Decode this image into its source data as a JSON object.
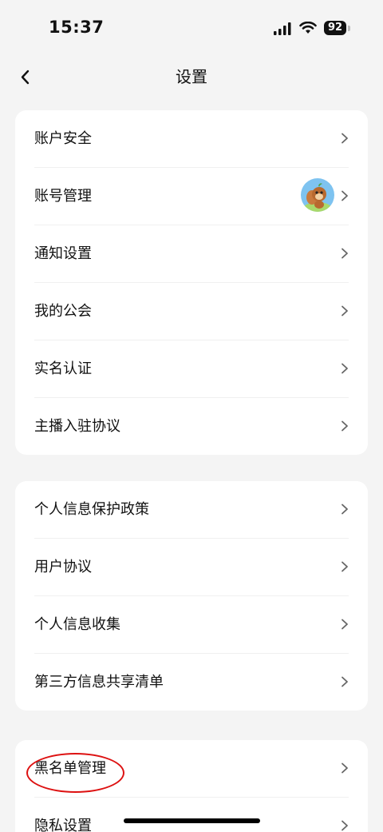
{
  "status_bar": {
    "time": "15:37",
    "battery": "92"
  },
  "nav": {
    "title": "设置"
  },
  "groups": [
    {
      "items": [
        {
          "label": "账户安全"
        },
        {
          "label": "账号管理"
        },
        {
          "label": "通知设置"
        },
        {
          "label": "我的公会"
        },
        {
          "label": "实名认证"
        },
        {
          "label": "主播入驻协议"
        }
      ]
    },
    {
      "items": [
        {
          "label": "个人信息保护政策"
        },
        {
          "label": "用户协议"
        },
        {
          "label": "个人信息收集"
        },
        {
          "label": "第三方信息共享清单"
        }
      ]
    },
    {
      "items": [
        {
          "label": "黑名单管理"
        },
        {
          "label": "隐私设置"
        }
      ]
    }
  ],
  "colors": {
    "background": "#f4f4f4",
    "card": "#ffffff",
    "annotation": "#dd1111"
  }
}
